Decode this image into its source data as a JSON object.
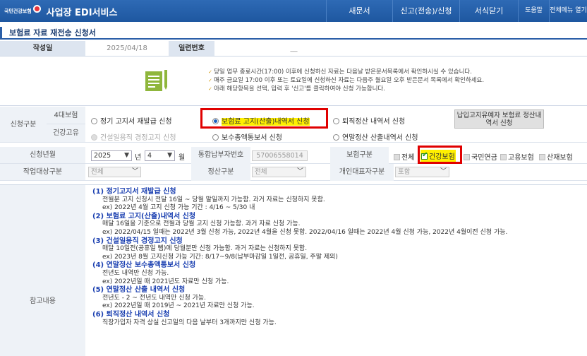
{
  "header": {
    "logo_text": "국민건강보험",
    "app_title": "사업장 EDI서비스",
    "nav": [
      "새문서",
      "신고(전송)/신청",
      "서식닫기",
      "도움말",
      "전체메뉴 열기"
    ]
  },
  "page_title": "보험료 자료 재전송 신청서",
  "form_header": {
    "date_label": "작성일",
    "date_value": "2025/04/18",
    "serial_label": "일련번호",
    "serial_value": "__"
  },
  "notice": [
    "당일 업무 종료시간(17:00) 이후에 신청하신 자료는 다음날 받은문서목록에서 확인하시실 수 있습니다.",
    "매주 금요일 17:00 이후 또는 토요일에 신청하신 자료는 다음주 월요일 오후 받은문서 목록에서 확인하세요.",
    "아래 해당항목을 선택, 입력 후 '신고'를 클릭하여야 신청 가능합니다."
  ],
  "apply_type": {
    "label": "신청구분",
    "group1_label": "4대보험",
    "group2_label": "건강고유",
    "options_row1": [
      "정기 고지서 재발급 신청",
      "보험료 고지(산출)내역서 신청",
      "퇴직정산 내역서 신청"
    ],
    "options_row2": [
      "건설일용직 경정고지 신청",
      "보수총액통보서 신청",
      "연말정산 산출내역서 신청"
    ],
    "selected": "보험료 고지(산출)내역서 신청",
    "extra_button": "납입고지유예자 보험료 정산내역서 신청"
  },
  "request_month": {
    "label": "신청년월",
    "year": "2025",
    "year_unit": "년",
    "month": "4",
    "month_unit": "월"
  },
  "bill_number": {
    "label": "통합납부자번호",
    "value": "57006558014"
  },
  "insurance_type": {
    "label": "보험구분",
    "options": [
      "전체",
      "건강보험",
      "국민연금",
      "고용보험",
      "산재보험"
    ],
    "checked": "건강보험"
  },
  "work_type": {
    "label": "작업대상구분",
    "value": "전체"
  },
  "settle_type": {
    "label": "정산구분",
    "value": "전체"
  },
  "rep_type": {
    "label": "개인대표자구분",
    "value": "포함"
  },
  "reference": {
    "label": "참고내용",
    "items": [
      {
        "title": "(1) 정기고지서 재발급 신청",
        "lines": [
          "전월분 고지 신청시 전달 16일 ~ 당월 말일까지 가능함. 과거 자료는 신청하지 못함.",
          "ex) 2022년 4월 고지 신청 가능 기간 : 4/16 ~ 5/30 내"
        ]
      },
      {
        "title": "(2) 보험료 고지(산출)내역서 신청",
        "lines": [
          "매달 16일을 기준으로 전월과 당월 고지 신청 가능함. 과거 자료 신청 가능.",
          "ex) 2022/04/15 일때는 2022년 3월 신청 가능, 2022년 4월을 신청 못함. 2022/04/16 일때는 2022년 4월 신청 가능, 2022년 4월이전 신청 가능."
        ]
      },
      {
        "title": "(3) 건설일용직 경정고지 신청",
        "lines": [
          "매달 10일전(공휴일 뻼)에 당월분만 신청 가능함. 과거 자료는 신청하지 못함.",
          "ex) 2023년 8월 고지신청 가능 기간: 8/17~9/8(납부마감일 1일전, 공휴일, 주말 제외)"
        ]
      },
      {
        "title": "(4) 연말정산 보수총액통보서 신청",
        "lines": [
          "전년도 내역만 신청 가능.",
          "ex) 2022년일 때 2021년도 자료만 신청 가능."
        ]
      },
      {
        "title": "(5) 연말정산 산출 내역서 신청",
        "lines": [
          "전년도 - 2 ~ 전년도 내역만 신청 가능.",
          "ex) 2022년일 때 2019년 ~ 2021년 자료만 신청 가능."
        ]
      },
      {
        "title": "(6) 퇴직정산 내역서 신청",
        "lines": [
          "직장가입자 자격 상실 신고일의 다음 날부터 3개까지만 신청 가능."
        ]
      }
    ]
  }
}
